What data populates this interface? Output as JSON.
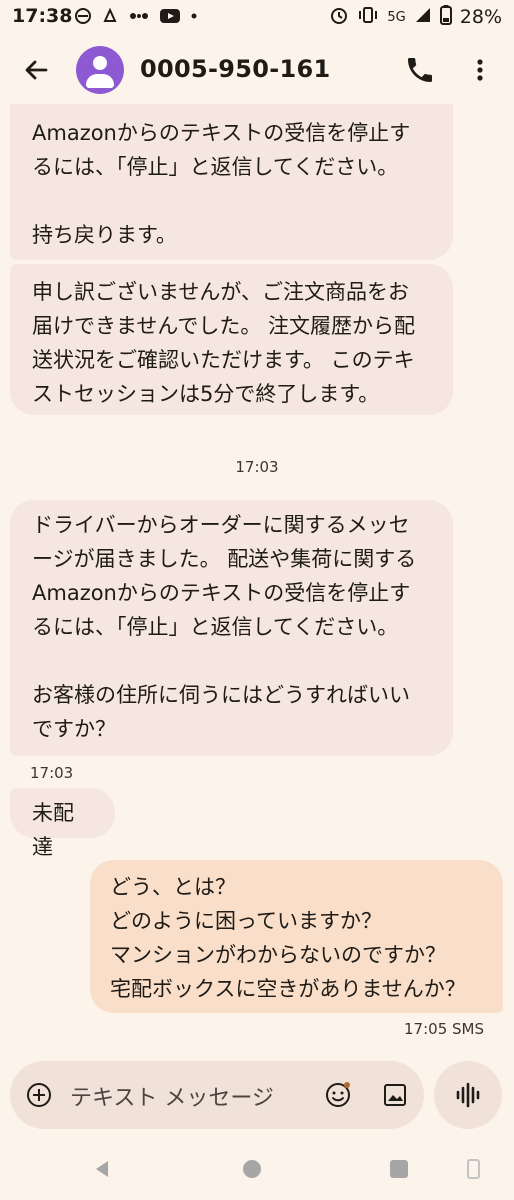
{
  "status_bar": {
    "time": "17:38",
    "network": "5G",
    "battery": "28%"
  },
  "header": {
    "contact": "0005-950-161"
  },
  "messages": [
    {
      "direction": "incoming",
      "text": "Amazonからのテキストの受信を停止す\nるには、「停止」と返信してください。\n\n持ち戻ります。"
    },
    {
      "direction": "incoming",
      "text": "申し訳ございませんが、ご注文商品をお\n届けできませんでした。 注文履歴から配\n送状況をご確認いただけます。 このテキ\nストセッションは5分で終了します。"
    },
    {
      "direction": "incoming",
      "text": "ドライバーからオーダーに関するメッセ\nージが届きました。 配送や集荷に関する\nAmazonからのテキストの受信を停止す\nるには、「停止」と返信してください。\n\nお客様の住所に伺うにはどうすればいい\nですか？"
    },
    {
      "direction": "incoming",
      "text": "未配達"
    },
    {
      "direction": "outgoing",
      "text": "どう、とは？\nどのように困っていますか？\nマンションがわからないのですか？\n宅配ボックスに空きがありませんか？"
    }
  ],
  "timestamps": {
    "divider": "17:03",
    "incoming_last": "17:03",
    "outgoing_last": "17:05 SMS"
  },
  "composer": {
    "placeholder": "テキスト メッセージ"
  },
  "colors": {
    "background": "#fcf3ea",
    "incoming_bubble": "#f5e6df",
    "outgoing_bubble": "#f9dec9",
    "avatar": "#8e5ad4"
  }
}
